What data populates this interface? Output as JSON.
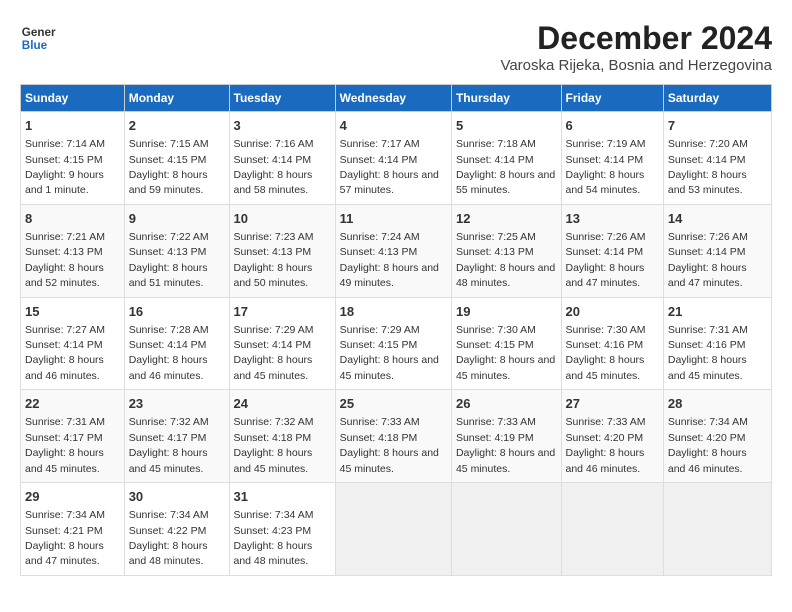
{
  "logo": {
    "line1": "General",
    "line2": "Blue"
  },
  "title": "December 2024",
  "subtitle": "Varoska Rijeka, Bosnia and Herzegovina",
  "days_of_week": [
    "Sunday",
    "Monday",
    "Tuesday",
    "Wednesday",
    "Thursday",
    "Friday",
    "Saturday"
  ],
  "weeks": [
    [
      {
        "day": "1",
        "sunrise": "Sunrise: 7:14 AM",
        "sunset": "Sunset: 4:15 PM",
        "daylight": "Daylight: 9 hours and 1 minute."
      },
      {
        "day": "2",
        "sunrise": "Sunrise: 7:15 AM",
        "sunset": "Sunset: 4:15 PM",
        "daylight": "Daylight: 8 hours and 59 minutes."
      },
      {
        "day": "3",
        "sunrise": "Sunrise: 7:16 AM",
        "sunset": "Sunset: 4:14 PM",
        "daylight": "Daylight: 8 hours and 58 minutes."
      },
      {
        "day": "4",
        "sunrise": "Sunrise: 7:17 AM",
        "sunset": "Sunset: 4:14 PM",
        "daylight": "Daylight: 8 hours and 57 minutes."
      },
      {
        "day": "5",
        "sunrise": "Sunrise: 7:18 AM",
        "sunset": "Sunset: 4:14 PM",
        "daylight": "Daylight: 8 hours and 55 minutes."
      },
      {
        "day": "6",
        "sunrise": "Sunrise: 7:19 AM",
        "sunset": "Sunset: 4:14 PM",
        "daylight": "Daylight: 8 hours and 54 minutes."
      },
      {
        "day": "7",
        "sunrise": "Sunrise: 7:20 AM",
        "sunset": "Sunset: 4:14 PM",
        "daylight": "Daylight: 8 hours and 53 minutes."
      }
    ],
    [
      {
        "day": "8",
        "sunrise": "Sunrise: 7:21 AM",
        "sunset": "Sunset: 4:13 PM",
        "daylight": "Daylight: 8 hours and 52 minutes."
      },
      {
        "day": "9",
        "sunrise": "Sunrise: 7:22 AM",
        "sunset": "Sunset: 4:13 PM",
        "daylight": "Daylight: 8 hours and 51 minutes."
      },
      {
        "day": "10",
        "sunrise": "Sunrise: 7:23 AM",
        "sunset": "Sunset: 4:13 PM",
        "daylight": "Daylight: 8 hours and 50 minutes."
      },
      {
        "day": "11",
        "sunrise": "Sunrise: 7:24 AM",
        "sunset": "Sunset: 4:13 PM",
        "daylight": "Daylight: 8 hours and 49 minutes."
      },
      {
        "day": "12",
        "sunrise": "Sunrise: 7:25 AM",
        "sunset": "Sunset: 4:13 PM",
        "daylight": "Daylight: 8 hours and 48 minutes."
      },
      {
        "day": "13",
        "sunrise": "Sunrise: 7:26 AM",
        "sunset": "Sunset: 4:14 PM",
        "daylight": "Daylight: 8 hours and 47 minutes."
      },
      {
        "day": "14",
        "sunrise": "Sunrise: 7:26 AM",
        "sunset": "Sunset: 4:14 PM",
        "daylight": "Daylight: 8 hours and 47 minutes."
      }
    ],
    [
      {
        "day": "15",
        "sunrise": "Sunrise: 7:27 AM",
        "sunset": "Sunset: 4:14 PM",
        "daylight": "Daylight: 8 hours and 46 minutes."
      },
      {
        "day": "16",
        "sunrise": "Sunrise: 7:28 AM",
        "sunset": "Sunset: 4:14 PM",
        "daylight": "Daylight: 8 hours and 46 minutes."
      },
      {
        "day": "17",
        "sunrise": "Sunrise: 7:29 AM",
        "sunset": "Sunset: 4:14 PM",
        "daylight": "Daylight: 8 hours and 45 minutes."
      },
      {
        "day": "18",
        "sunrise": "Sunrise: 7:29 AM",
        "sunset": "Sunset: 4:15 PM",
        "daylight": "Daylight: 8 hours and 45 minutes."
      },
      {
        "day": "19",
        "sunrise": "Sunrise: 7:30 AM",
        "sunset": "Sunset: 4:15 PM",
        "daylight": "Daylight: 8 hours and 45 minutes."
      },
      {
        "day": "20",
        "sunrise": "Sunrise: 7:30 AM",
        "sunset": "Sunset: 4:16 PM",
        "daylight": "Daylight: 8 hours and 45 minutes."
      },
      {
        "day": "21",
        "sunrise": "Sunrise: 7:31 AM",
        "sunset": "Sunset: 4:16 PM",
        "daylight": "Daylight: 8 hours and 45 minutes."
      }
    ],
    [
      {
        "day": "22",
        "sunrise": "Sunrise: 7:31 AM",
        "sunset": "Sunset: 4:17 PM",
        "daylight": "Daylight: 8 hours and 45 minutes."
      },
      {
        "day": "23",
        "sunrise": "Sunrise: 7:32 AM",
        "sunset": "Sunset: 4:17 PM",
        "daylight": "Daylight: 8 hours and 45 minutes."
      },
      {
        "day": "24",
        "sunrise": "Sunrise: 7:32 AM",
        "sunset": "Sunset: 4:18 PM",
        "daylight": "Daylight: 8 hours and 45 minutes."
      },
      {
        "day": "25",
        "sunrise": "Sunrise: 7:33 AM",
        "sunset": "Sunset: 4:18 PM",
        "daylight": "Daylight: 8 hours and 45 minutes."
      },
      {
        "day": "26",
        "sunrise": "Sunrise: 7:33 AM",
        "sunset": "Sunset: 4:19 PM",
        "daylight": "Daylight: 8 hours and 45 minutes."
      },
      {
        "day": "27",
        "sunrise": "Sunrise: 7:33 AM",
        "sunset": "Sunset: 4:20 PM",
        "daylight": "Daylight: 8 hours and 46 minutes."
      },
      {
        "day": "28",
        "sunrise": "Sunrise: 7:34 AM",
        "sunset": "Sunset: 4:20 PM",
        "daylight": "Daylight: 8 hours and 46 minutes."
      }
    ],
    [
      {
        "day": "29",
        "sunrise": "Sunrise: 7:34 AM",
        "sunset": "Sunset: 4:21 PM",
        "daylight": "Daylight: 8 hours and 47 minutes."
      },
      {
        "day": "30",
        "sunrise": "Sunrise: 7:34 AM",
        "sunset": "Sunset: 4:22 PM",
        "daylight": "Daylight: 8 hours and 48 minutes."
      },
      {
        "day": "31",
        "sunrise": "Sunrise: 7:34 AM",
        "sunset": "Sunset: 4:23 PM",
        "daylight": "Daylight: 8 hours and 48 minutes."
      },
      null,
      null,
      null,
      null
    ]
  ]
}
